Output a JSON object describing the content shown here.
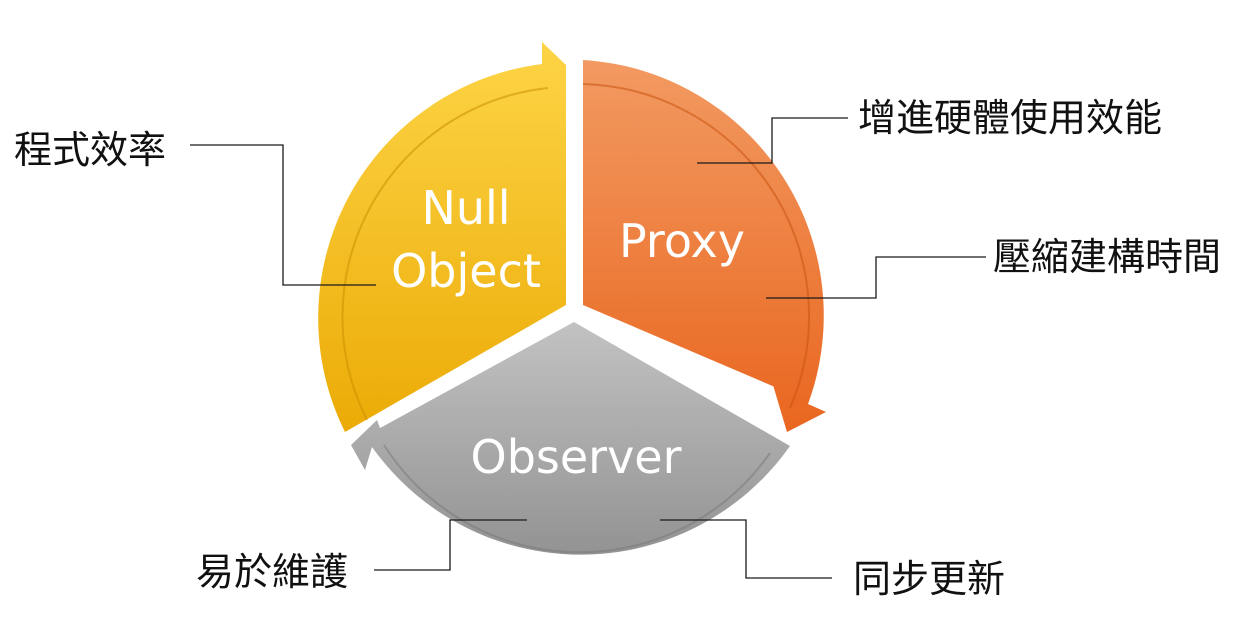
{
  "segments": {
    "null_object": {
      "line1": "Null",
      "line2": "Object"
    },
    "proxy": {
      "label": "Proxy"
    },
    "observer": {
      "label": "Observer"
    }
  },
  "annotations": {
    "program_efficiency": "程式效率",
    "hardware_performance": "增進硬體使用效能",
    "build_time": "壓縮建構時間",
    "maintainability": "易於維護",
    "sync_update": "同步更新"
  },
  "colors": {
    "null_object_light": "#FDD03A",
    "null_object_dark": "#E8A800",
    "proxy_light": "#F2955A",
    "proxy_dark": "#E8621C",
    "observer_light": "#BDBDBD",
    "observer_dark": "#8F8F8F"
  }
}
